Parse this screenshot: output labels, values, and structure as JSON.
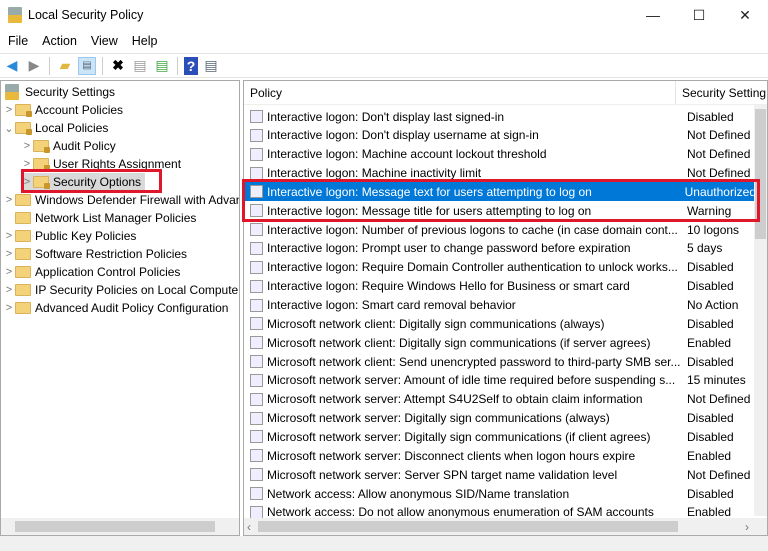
{
  "window": {
    "title": "Local Security Policy",
    "minimize": "—",
    "maximize": "☐",
    "close": "✕"
  },
  "menu": [
    "File",
    "Action",
    "View",
    "Help"
  ],
  "toolbar": [
    "back",
    "forward",
    "up-folder",
    "show-hide-tree",
    "delete",
    "properties",
    "export-list",
    "help",
    "show-hide-action-pane"
  ],
  "tree": {
    "root": "Security Settings",
    "items": [
      {
        "label": "Account Policies",
        "indent": 1,
        "chev": ">",
        "lock": true
      },
      {
        "label": "Local Policies",
        "indent": 1,
        "chev": "v",
        "lock": true
      },
      {
        "label": "Audit Policy",
        "indent": 2,
        "chev": ">",
        "lock": true
      },
      {
        "label": "User Rights Assignment",
        "indent": 2,
        "chev": ">",
        "lock": true
      },
      {
        "label": "Security Options",
        "indent": 2,
        "chev": ">",
        "lock": true,
        "selected": true
      },
      {
        "label": "Windows Defender Firewall with Advanced Security",
        "indent": 1,
        "chev": ">"
      },
      {
        "label": "Network List Manager Policies",
        "indent": 1,
        "chev": ""
      },
      {
        "label": "Public Key Policies",
        "indent": 1,
        "chev": ">"
      },
      {
        "label": "Software Restriction Policies",
        "indent": 1,
        "chev": ">"
      },
      {
        "label": "Application Control Policies",
        "indent": 1,
        "chev": ">"
      },
      {
        "label": "IP Security Policies on Local Computer",
        "indent": 1,
        "chev": ">"
      },
      {
        "label": "Advanced Audit Policy Configuration",
        "indent": 1,
        "chev": ">"
      }
    ]
  },
  "list": {
    "columns": [
      "Policy",
      "Security Setting"
    ],
    "rows": [
      [
        "Interactive logon: Don't display last signed-in",
        "Disabled"
      ],
      [
        "Interactive logon: Don't display username at sign-in",
        "Not Defined"
      ],
      [
        "Interactive logon: Machine account lockout threshold",
        "Not Defined"
      ],
      [
        "Interactive logon: Machine inactivity limit",
        "Not Defined"
      ],
      [
        "Interactive logon: Message text for users attempting to log on",
        "Unauthorized"
      ],
      [
        "Interactive logon: Message title for users attempting to log on",
        "Warning"
      ],
      [
        "Interactive logon: Number of previous logons to cache (in case domain cont...",
        "10 logons"
      ],
      [
        "Interactive logon: Prompt user to change password before expiration",
        "5 days"
      ],
      [
        "Interactive logon: Require Domain Controller authentication to unlock works...",
        "Disabled"
      ],
      [
        "Interactive logon: Require Windows Hello for Business or smart card",
        "Disabled"
      ],
      [
        "Interactive logon: Smart card removal behavior",
        "No Action"
      ],
      [
        "Microsoft network client: Digitally sign communications (always)",
        "Disabled"
      ],
      [
        "Microsoft network client: Digitally sign communications (if server agrees)",
        "Enabled"
      ],
      [
        "Microsoft network client: Send unencrypted password to third-party SMB ser...",
        "Disabled"
      ],
      [
        "Microsoft network server: Amount of idle time required before suspending s...",
        "15 minutes"
      ],
      [
        "Microsoft network server: Attempt S4U2Self to obtain claim information",
        "Not Defined"
      ],
      [
        "Microsoft network server: Digitally sign communications (always)",
        "Disabled"
      ],
      [
        "Microsoft network server: Digitally sign communications (if client agrees)",
        "Disabled"
      ],
      [
        "Microsoft network server: Disconnect clients when logon hours expire",
        "Enabled"
      ],
      [
        "Microsoft network server: Server SPN target name validation level",
        "Not Defined"
      ],
      [
        "Network access: Allow anonymous SID/Name translation",
        "Disabled"
      ],
      [
        "Network access: Do not allow anonymous enumeration of SAM accounts",
        "Enabled"
      ]
    ],
    "selected_index": 4
  },
  "colors": {
    "selection": "#0078d7",
    "highlight_box": "#e0162b"
  }
}
